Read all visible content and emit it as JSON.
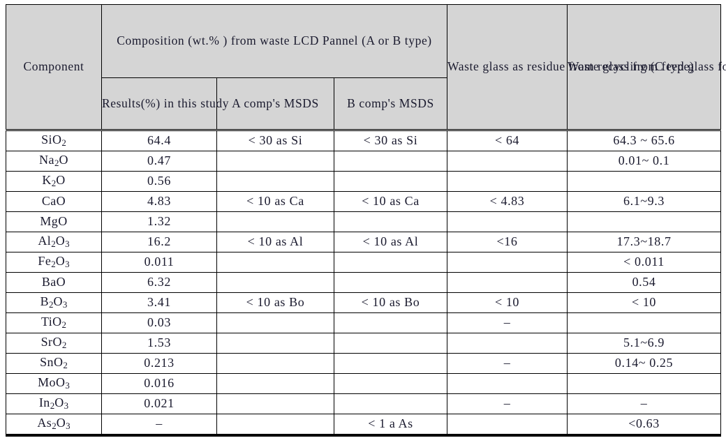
{
  "table": {
    "header": {
      "component_label": "Component",
      "group_span_label": "Composition (wt.% ) from waste LCD Pannel (A or B type)",
      "sub_results": "Results(%) in this study",
      "sub_a_msds": "A comp's MSDS",
      "sub_b_msds": "B comp's MSDS",
      "col_c_type": "Waste glass as residue from recycling (C type)",
      "col_d_type": "Waste glass from feed glass for LCD Pannel (D type, waste bare glass)"
    },
    "columns": [
      "Component",
      "Results(%) in this study",
      "A comp's MSDS",
      "B comp's MSDS",
      "Waste glass as residue from recycling (C type)",
      "Waste glass from feed glass for LCD Pannel (D type, waste bare glass)"
    ],
    "rows": [
      {
        "component": "SiO2",
        "component_base": "SiO",
        "component_sub": "2",
        "results": "64.4",
        "a_msds": "< 30  as Si",
        "b_msds": "< 30 as Si",
        "c_type": "< 64",
        "d_type": "64.3 ~ 65.6"
      },
      {
        "component": "Na2O",
        "component_base": "Na",
        "component_sub": "2",
        "component_tail": "O",
        "results": "0.47",
        "a_msds": "",
        "b_msds": "",
        "c_type": "",
        "d_type": "0.01~ 0.1"
      },
      {
        "component": "K2O",
        "component_base": "K",
        "component_sub": "2",
        "component_tail": "O",
        "results": "0.56",
        "a_msds": "",
        "b_msds": "",
        "c_type": "",
        "d_type": ""
      },
      {
        "component": "CaO",
        "component_base": "CaO",
        "component_sub": "",
        "results": "4.83",
        "a_msds": "< 10 as Ca",
        "b_msds": "< 10 as Ca",
        "c_type": "< 4.83",
        "d_type": "6.1~9.3"
      },
      {
        "component": "MgO",
        "component_base": "MgO",
        "component_sub": "",
        "results": "1.32",
        "a_msds": "",
        "b_msds": "",
        "c_type": "",
        "d_type": ""
      },
      {
        "component": "Al2O3",
        "component_base": "Al",
        "component_sub": "2",
        "component_tail": "O",
        "component_sub2": "3",
        "results": "16.2",
        "a_msds": "< 10 as Al",
        "b_msds": "< 10 as Al",
        "c_type": "<16",
        "d_type": "17.3~18.7"
      },
      {
        "component": "Fe2O3",
        "component_base": "Fe",
        "component_sub": "2",
        "component_tail": "O",
        "component_sub2": "3",
        "results": "0.011",
        "a_msds": "",
        "b_msds": "",
        "c_type": "",
        "d_type": "< 0.011"
      },
      {
        "component": "BaO",
        "component_base": "BaO",
        "component_sub": "",
        "results": "6.32",
        "a_msds": "",
        "b_msds": "",
        "c_type": "",
        "d_type": "0.54"
      },
      {
        "component": "B2O3",
        "component_base": "B",
        "component_sub": "2",
        "component_tail": "O",
        "component_sub2": "3",
        "results": "3.41",
        "a_msds": "< 10 as Bo",
        "b_msds": "< 10 as Bo",
        "c_type": "< 10",
        "d_type": "< 10"
      },
      {
        "component": "TiO2",
        "component_base": "TiO",
        "component_sub": "2",
        "results": "0.03",
        "a_msds": "",
        "b_msds": "",
        "c_type": "–",
        "d_type": ""
      },
      {
        "component": "SrO2",
        "component_base": "SrO",
        "component_sub": "2",
        "results": "1.53",
        "a_msds": "",
        "b_msds": "",
        "c_type": "",
        "d_type": "5.1~6.9"
      },
      {
        "component": "SnO2",
        "component_base": "SnO",
        "component_sub": "2",
        "results": "0.213",
        "a_msds": "",
        "b_msds": "",
        "c_type": "–",
        "d_type": "0.14~ 0.25"
      },
      {
        "component": "MoO3",
        "component_base": "MoO",
        "component_sub": "3",
        "results": "0.016",
        "a_msds": "",
        "b_msds": "",
        "c_type": "",
        "d_type": ""
      },
      {
        "component": "In2O3",
        "component_base": "In",
        "component_sub": "2",
        "component_tail": "O",
        "component_sub2": "3",
        "results": "0.021",
        "a_msds": "",
        "b_msds": "",
        "c_type": "–",
        "d_type": "–"
      },
      {
        "component": "As2O3",
        "component_base": "As",
        "component_sub": "2",
        "component_tail": "O",
        "component_sub2": "3",
        "results": "–",
        "a_msds": "",
        "b_msds": "< 1 a As",
        "c_type": "",
        "d_type": "<0.63"
      }
    ]
  },
  "style": {
    "header_bg": "#d5d5d5",
    "border_color": "#000000",
    "text_color": "#1a1a2e"
  }
}
